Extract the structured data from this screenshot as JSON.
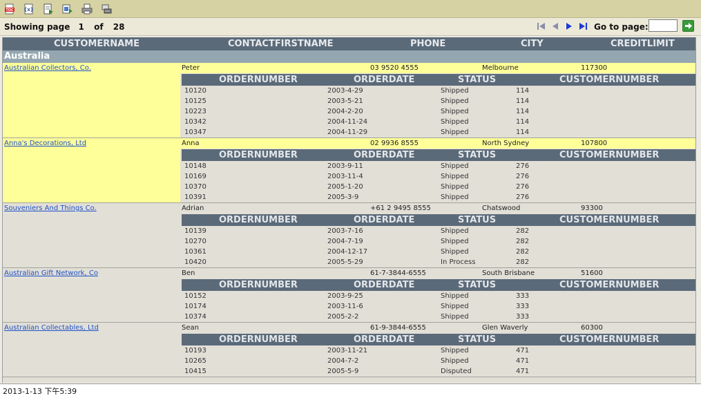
{
  "toolbar": {
    "icons": [
      "toc-icon",
      "export-data-icon",
      "export-report-icon",
      "export-content-icon",
      "print-icon",
      "print-server-icon"
    ]
  },
  "nav": {
    "showing_label": "Showing page",
    "current_page": "1",
    "of_label": "of",
    "total_pages": "28",
    "goto_label": "Go to page:",
    "goto_value": ""
  },
  "table": {
    "headers": [
      "CUSTOMERNAME",
      "CONTACTFIRSTNAME",
      "PHONE",
      "CITY",
      "CREDITLIMIT"
    ],
    "order_headers": [
      "ORDERNUMBER",
      "ORDERDATE",
      "STATUS",
      "CUSTOMERNUMBER"
    ]
  },
  "group": {
    "country": "Australia"
  },
  "customers": [
    {
      "name": "Australian Collectors, Co.",
      "contact": "Peter",
      "phone": "03 9520 4555",
      "city": "Melbourne",
      "credit": "117300",
      "orders": [
        {
          "num": "10120",
          "date": "2003-4-29",
          "status": "Shipped",
          "cust": "114"
        },
        {
          "num": "10125",
          "date": "2003-5-21",
          "status": "Shipped",
          "cust": "114"
        },
        {
          "num": "10223",
          "date": "2004-2-20",
          "status": "Shipped",
          "cust": "114"
        },
        {
          "num": "10342",
          "date": "2004-11-24",
          "status": "Shipped",
          "cust": "114"
        },
        {
          "num": "10347",
          "date": "2004-11-29",
          "status": "Shipped",
          "cust": "114"
        }
      ]
    },
    {
      "name": "Anna's Decorations, Ltd",
      "contact": "Anna",
      "phone": "02 9936 8555",
      "city": "North Sydney",
      "credit": "107800",
      "orders": [
        {
          "num": "10148",
          "date": "2003-9-11",
          "status": "Shipped",
          "cust": "276"
        },
        {
          "num": "10169",
          "date": "2003-11-4",
          "status": "Shipped",
          "cust": "276"
        },
        {
          "num": "10370",
          "date": "2005-1-20",
          "status": "Shipped",
          "cust": "276"
        },
        {
          "num": "10391",
          "date": "2005-3-9",
          "status": "Shipped",
          "cust": "276"
        }
      ]
    },
    {
      "name": "Souveniers And Things Co.",
      "contact": "Adrian",
      "phone": "+61 2 9495 8555",
      "city": "Chatswood",
      "credit": "93300",
      "orders": [
        {
          "num": "10139",
          "date": "2003-7-16",
          "status": "Shipped",
          "cust": "282"
        },
        {
          "num": "10270",
          "date": "2004-7-19",
          "status": "Shipped",
          "cust": "282"
        },
        {
          "num": "10361",
          "date": "2004-12-17",
          "status": "Shipped",
          "cust": "282"
        },
        {
          "num": "10420",
          "date": "2005-5-29",
          "status": "In Process",
          "cust": "282"
        }
      ]
    },
    {
      "name": "Australian Gift Network, Co",
      "contact": "Ben",
      "phone": "61-7-3844-6555",
      "city": "South Brisbane",
      "credit": "51600",
      "orders": [
        {
          "num": "10152",
          "date": "2003-9-25",
          "status": "Shipped",
          "cust": "333"
        },
        {
          "num": "10174",
          "date": "2003-11-6",
          "status": "Shipped",
          "cust": "333"
        },
        {
          "num": "10374",
          "date": "2005-2-2",
          "status": "Shipped",
          "cust": "333"
        }
      ]
    },
    {
      "name": "Australian Collectables, Ltd",
      "contact": "Sean",
      "phone": "61-9-3844-6555",
      "city": "Glen Waverly",
      "credit": "60300",
      "orders": [
        {
          "num": "10193",
          "date": "2003-11-21",
          "status": "Shipped",
          "cust": "471"
        },
        {
          "num": "10265",
          "date": "2004-7-2",
          "status": "Shipped",
          "cust": "471"
        },
        {
          "num": "10415",
          "date": "2005-5-9",
          "status": "Disputed",
          "cust": "471"
        }
      ]
    }
  ],
  "footer": {
    "timestamp": "2013-1-13 下午5:39"
  }
}
